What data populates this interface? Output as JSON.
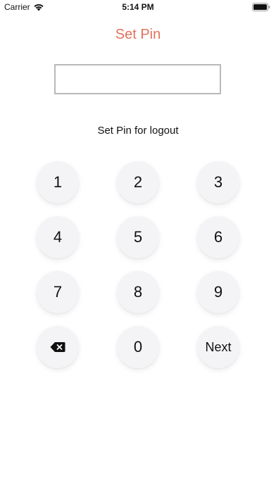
{
  "status_bar": {
    "carrier": "Carrier",
    "time": "5:14 PM",
    "wifi_icon": "wifi-icon",
    "battery_icon": "battery-icon"
  },
  "title": "Set Pin",
  "pin_field": {
    "value": "",
    "placeholder": ""
  },
  "instruction": "Set Pin for logout",
  "keypad": {
    "keys": [
      "1",
      "2",
      "3",
      "4",
      "5",
      "6",
      "7",
      "8",
      "9",
      "0"
    ],
    "backspace_icon": "backspace-icon",
    "next_label": "Next"
  },
  "colors": {
    "title": "#e0735b",
    "key_background": "#f4f4f7",
    "field_border": "#b9b9b9"
  }
}
